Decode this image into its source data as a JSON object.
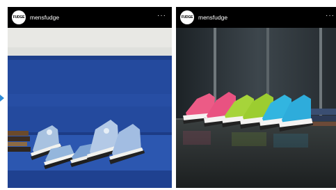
{
  "posts": [
    {
      "account": {
        "avatar_text": "FUDGE",
        "username": "mensfudge"
      },
      "more_label": "···"
    },
    {
      "account": {
        "avatar_text": "FUDGE",
        "username": "mensfudge"
      },
      "more_label": "···"
    }
  ],
  "colors": {
    "sofa_blue": "#244a9e",
    "arrow_blue": "#2f8bd6",
    "pink_shoe": "#ec5b86",
    "green_shoe": "#a6d43a",
    "cyan_shoe": "#32b5e0"
  }
}
